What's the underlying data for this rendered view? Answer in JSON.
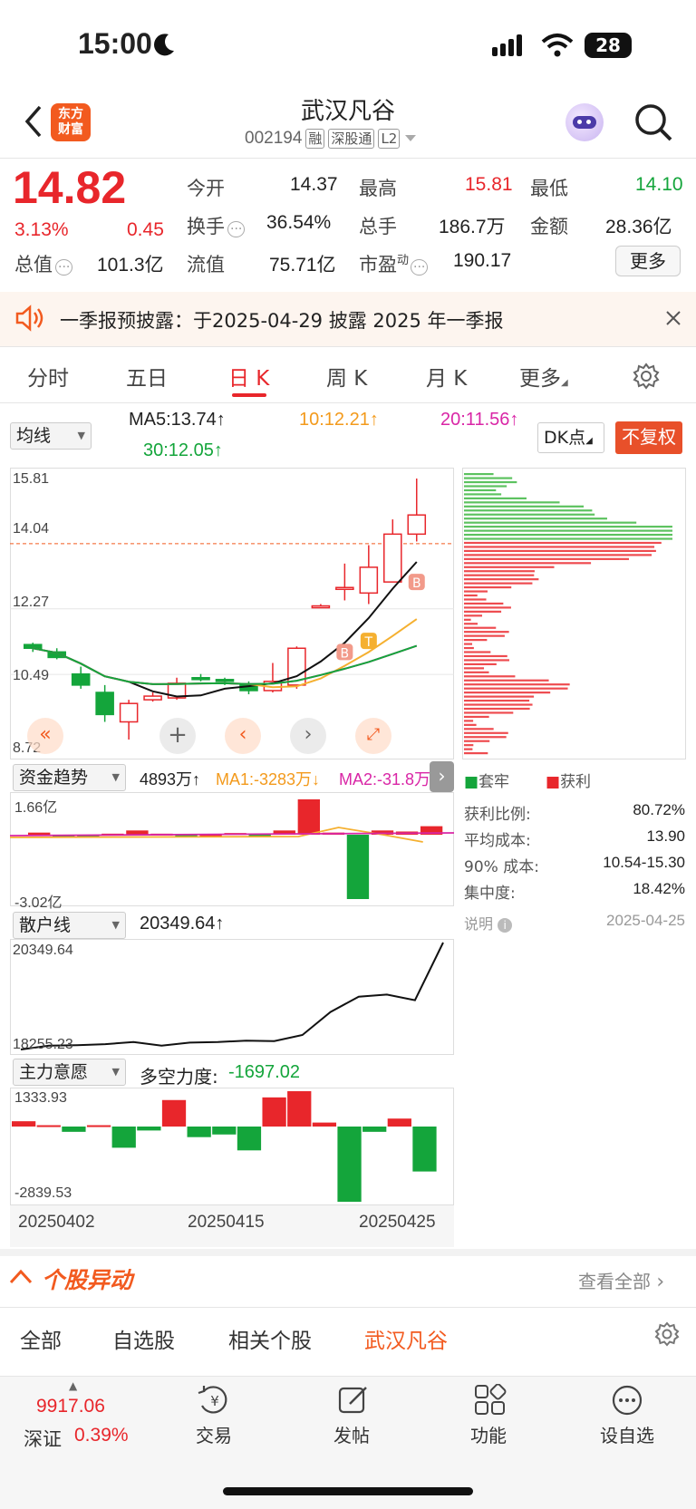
{
  "status": {
    "time": "15:00",
    "battery": "28"
  },
  "header": {
    "logo_line1": "东方",
    "logo_line2": "财富",
    "title": "武汉凡谷",
    "code": "002194",
    "tags": [
      "融",
      "深股通",
      "L2"
    ]
  },
  "quote": {
    "price": "14.82",
    "pct": "3.13%",
    "change": "0.45",
    "open_label": "今开",
    "open": "14.37",
    "high_label": "最高",
    "high": "15.81",
    "low_label": "最低",
    "low": "14.10",
    "turnover_label": "换手",
    "turnover": "36.54%",
    "volume_label": "总手",
    "volume": "186.7万",
    "amount_label": "金额",
    "amount": "28.36亿",
    "mktcap_label": "总值",
    "mktcap": "101.3亿",
    "float_label": "流值",
    "float": "75.71亿",
    "pe_label": "市盈",
    "pe_sup": "动",
    "pe": "190.17",
    "more": "更多"
  },
  "notice": {
    "text": "一季报预披露：于2025-04-29 披露 2025 年一季报"
  },
  "tabs": [
    "分时",
    "五日",
    "日 K",
    "周 K",
    "月 K",
    "更多"
  ],
  "ma": {
    "selector": "均线",
    "ma5": "MA5:13.74↑",
    "ma10": "10:12.21↑",
    "ma20": "20:11.56↑",
    "ma30": "30:12.05↑",
    "dk": "DK点",
    "fq": "不复权"
  },
  "kline": {
    "ylabels": [
      "15.81",
      "14.04",
      "12.27",
      "10.49",
      "8.72"
    ],
    "last_price": 14.04,
    "candles": [
      {
        "o": 11.3,
        "c": 11.2,
        "h": 11.35,
        "l": 11.1
      },
      {
        "o": 11.1,
        "c": 10.95,
        "h": 11.2,
        "l": 10.9
      },
      {
        "o": 10.5,
        "c": 10.2,
        "h": 10.7,
        "l": 10.1
      },
      {
        "o": 10.0,
        "c": 9.4,
        "h": 10.2,
        "l": 9.2
      },
      {
        "o": 9.2,
        "c": 9.7,
        "h": 9.8,
        "l": 8.72
      },
      {
        "o": 9.8,
        "c": 9.9,
        "h": 10.0,
        "l": 9.75
      },
      {
        "o": 9.85,
        "c": 10.25,
        "h": 10.4,
        "l": 9.8
      },
      {
        "o": 10.4,
        "c": 10.35,
        "h": 10.5,
        "l": 10.3
      },
      {
        "o": 10.35,
        "c": 10.3,
        "h": 10.4,
        "l": 10.2
      },
      {
        "o": 10.2,
        "c": 10.05,
        "h": 10.3,
        "l": 9.95
      },
      {
        "o": 10.05,
        "c": 10.3,
        "h": 10.8,
        "l": 10.0
      },
      {
        "o": 10.2,
        "c": 11.2,
        "h": 11.25,
        "l": 10.1
      },
      {
        "o": 12.3,
        "c": 12.35,
        "h": 12.4,
        "l": 12.3
      },
      {
        "o": 12.8,
        "c": 12.85,
        "h": 13.5,
        "l": 12.5
      },
      {
        "o": 12.7,
        "c": 13.4,
        "h": 14.0,
        "l": 12.4
      },
      {
        "o": 13.0,
        "c": 14.3,
        "h": 14.7,
        "l": 13.0
      },
      {
        "o": 14.3,
        "c": 14.82,
        "h": 15.81,
        "l": 14.1
      }
    ],
    "markers": [
      "B",
      "T",
      "B"
    ]
  },
  "distribution": {
    "legend_trap": "套牢",
    "legend_profit": "获利",
    "rows": [
      {
        "label": "获利比例:",
        "value": "80.72%"
      },
      {
        "label": "平均成本:",
        "value": "13.90"
      },
      {
        "label": "90% 成本:",
        "value": "10.54-15.30"
      },
      {
        "label": "集中度:",
        "value": "18.42%"
      }
    ],
    "note": "说明",
    "date": "2025-04-25"
  },
  "fund": {
    "selector": "资金趋势",
    "value": "4893万↑",
    "ma1": "MA1:-3283万↓",
    "ma2": "MA2:-31.8万",
    "ymax": "1.66亿",
    "ymin": "-3.02亿",
    "bars": [
      0.1,
      -0.05,
      -0.03,
      0.05,
      0.2,
      0.05,
      -0.03,
      0.02,
      0.08,
      -0.05,
      0.2,
      1.66,
      0.1,
      -3.02,
      0.2,
      0.15,
      0.4
    ]
  },
  "retail": {
    "selector": "散户线",
    "value": "20349.64↑",
    "ymax": "20349.64",
    "ymin": "18255.23",
    "points": [
      18255,
      18330,
      18340,
      18360,
      18400,
      18330,
      18390,
      18400,
      18430,
      18420,
      18540,
      18990,
      19290,
      19330,
      19220,
      20349.64
    ]
  },
  "intent": {
    "selector": "主力意愿",
    "label": "多空力度:",
    "value": "-1697.02",
    "ymax": "1333.93",
    "ymin": "-2839.53",
    "bars": [
      200,
      50,
      -200,
      50,
      -800,
      -150,
      1000,
      -400,
      -300,
      -900,
      1100,
      1333.93,
      150,
      -2839.53,
      -200,
      300,
      -1697.02
    ],
    "dates": [
      "20250402",
      "20250415",
      "20250425"
    ]
  },
  "movers": {
    "title": "个股异动",
    "viewall": "查看全部",
    "tabs": [
      "全部",
      "自选股",
      "相关个股",
      "武汉凡谷"
    ]
  },
  "bottom": {
    "index_value": "9917.06",
    "index_name": "深证",
    "index_pct": "0.39%",
    "items": [
      "交易",
      "发帖",
      "功能",
      "设自选"
    ]
  }
}
